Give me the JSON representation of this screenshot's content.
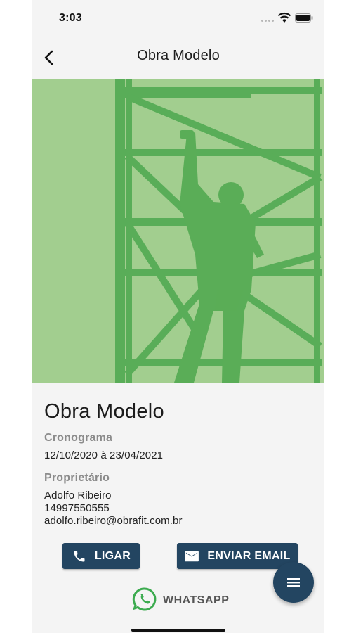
{
  "status_bar": {
    "time": "3:03",
    "signal_icon": "signal-icon",
    "wifi_icon": "wifi-icon",
    "battery_icon": "battery-icon"
  },
  "nav": {
    "back_icon": "chevron-left-icon",
    "title": "Obra Modelo"
  },
  "hero": {
    "description_icon": "construction-worker-scaffold-image",
    "tint_color": "#a7cf93"
  },
  "project": {
    "title": "Obra Modelo",
    "schedule_label": "Cronograma",
    "schedule_value": "12/10/2020 à 23/04/2021",
    "owner_label": "Proprietário",
    "owner_name": "Adolfo Ribeiro",
    "owner_phone": "14997550555",
    "owner_email": "adolfo.ribeiro@obrafit.com.br"
  },
  "actions": {
    "call_label": "LIGAR",
    "call_icon": "phone-icon",
    "email_label": "ENVIAR EMAIL",
    "email_icon": "mail-icon",
    "whatsapp_label": "WHATSAPP",
    "whatsapp_icon": "whatsapp-icon",
    "menu_icon": "menu-icon"
  },
  "colors": {
    "primary": "#234561",
    "background": "#f4f4f4",
    "whatsapp": "#3cab4f"
  }
}
